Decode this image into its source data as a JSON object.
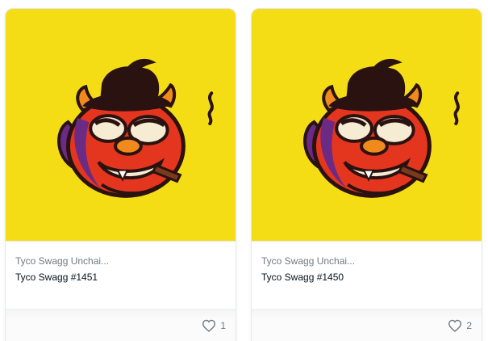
{
  "cards": [
    {
      "collection": "Tyco Swagg Unchai...",
      "name": "Tyco Swagg #1451",
      "likes": "1",
      "image_bg": "#f5dd16"
    },
    {
      "collection": "Tyco Swagg Unchai...",
      "name": "Tyco Swagg #1450",
      "likes": "2",
      "image_bg": "#f5dd16"
    }
  ],
  "icons": {
    "like": "heart-outline-icon",
    "artwork": "devil-character-illustration"
  }
}
